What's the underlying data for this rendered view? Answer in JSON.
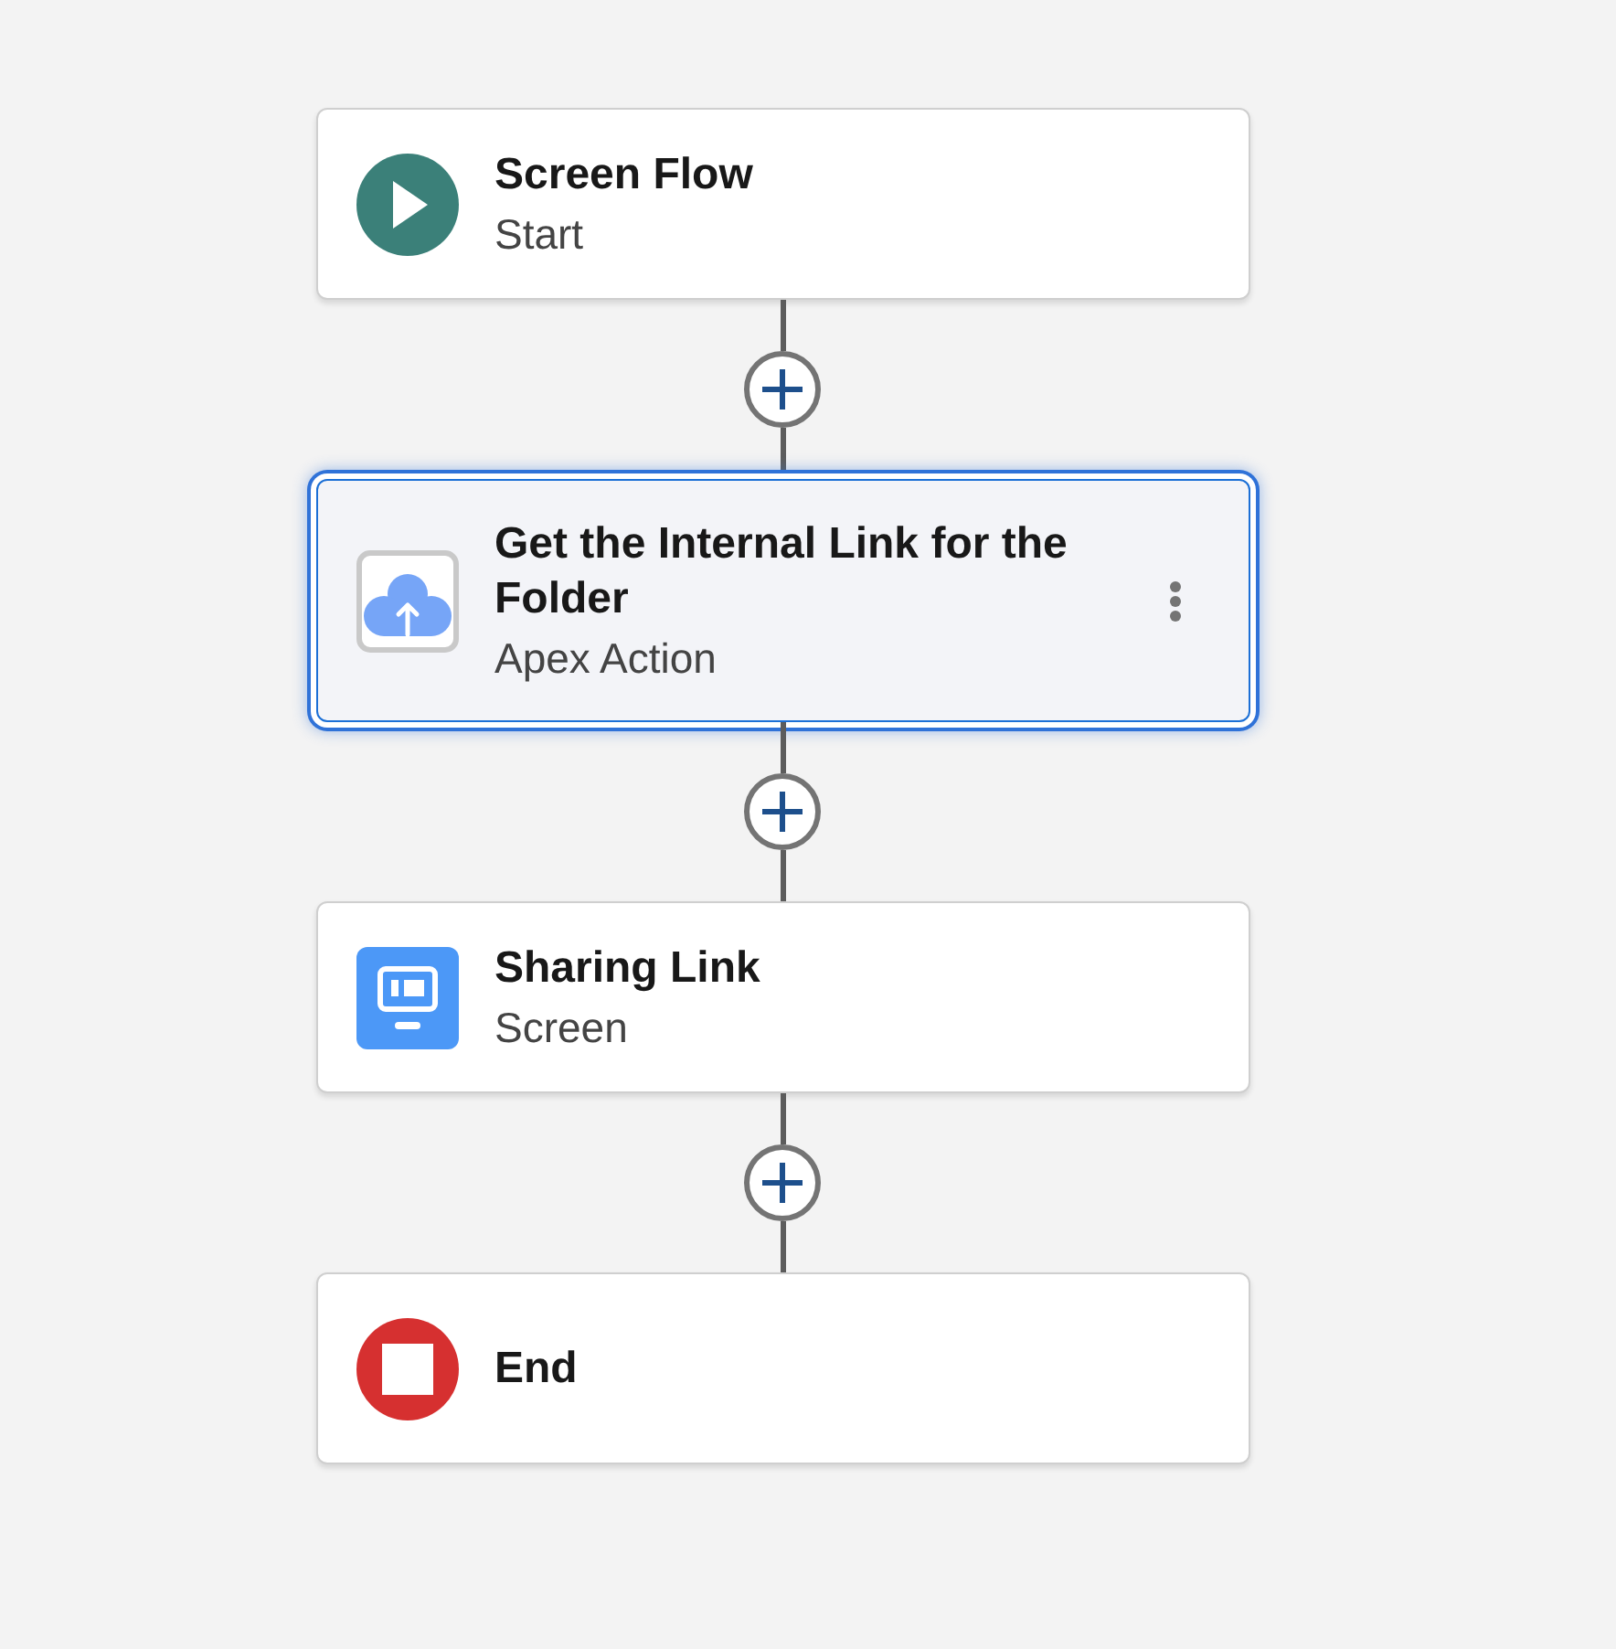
{
  "flow": {
    "nodes": [
      {
        "kind": "start",
        "title": "Screen Flow",
        "subtitle": "Start",
        "selected": false
      },
      {
        "kind": "action",
        "title": "Get the Internal Link for the Folder",
        "subtitle": "Apex Action",
        "selected": true
      },
      {
        "kind": "screen",
        "title": "Sharing Link",
        "subtitle": "Screen",
        "selected": false
      },
      {
        "kind": "end",
        "title": "End",
        "selected": false
      }
    ]
  }
}
